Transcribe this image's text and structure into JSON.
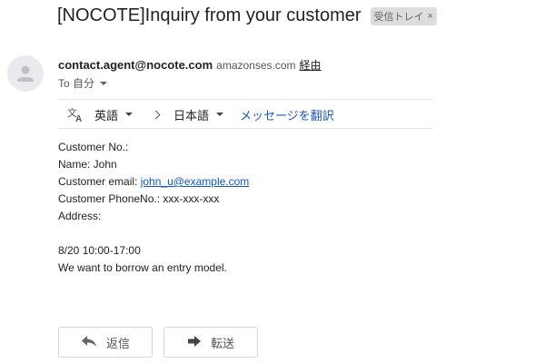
{
  "email": {
    "subject": "[NOCOTE]Inquiry from your customer",
    "label": {
      "name": "受信トレイ",
      "remove_glyph": "×"
    },
    "sender": {
      "email": "contact.agent@nocote.com",
      "via_domain": "amazonses.com",
      "via_link": "経由"
    },
    "to": "To 自分",
    "translate": {
      "source_lang": "英語",
      "target_lang": "日本語",
      "link": "メッセージを翻訳"
    },
    "body": {
      "lines": [
        "Customer No.:",
        "Name: John",
        "Customer email: ",
        "Customer PhoneNo.: xxx-xxx-xxx",
        "Address:",
        "",
        "8/20 10:00-17:00",
        "We want to borrow an entry model."
      ],
      "email_link": "john_u@example.com"
    },
    "actions": {
      "reply": "返信",
      "forward": "転送"
    }
  },
  "colors": {
    "link": "#1155cc",
    "translate_link": "#1a57c4",
    "label_bg": "#dddddd",
    "avatar_bg": "#e8eaed"
  },
  "icons": [
    "person-icon",
    "translate-icon",
    "reply-icon",
    "forward-icon"
  ]
}
